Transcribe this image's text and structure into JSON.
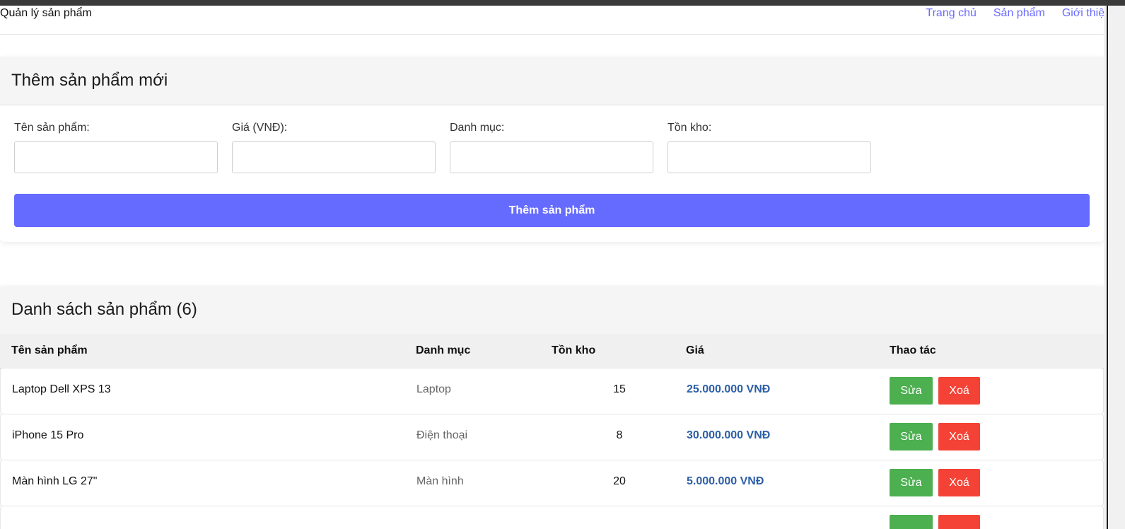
{
  "header": {
    "brand": "Quản lý sản phẩm",
    "nav": [
      "Trang chủ",
      "Sản phẩm",
      "Giới thiệu"
    ]
  },
  "add_form": {
    "title": "Thêm sản phẩm mới",
    "fields": [
      {
        "label": "Tên sản phẩm:",
        "value": ""
      },
      {
        "label": "Giá (VNĐ):",
        "value": ""
      },
      {
        "label": "Danh mục:",
        "value": ""
      },
      {
        "label": "Tồn kho:",
        "value": ""
      }
    ],
    "submit_label": "Thêm sản phẩm"
  },
  "product_list": {
    "title": "Danh sách sản phẩm (6)",
    "columns": [
      "Tên sản phẩm",
      "Danh mục",
      "Tồn kho",
      "Giá",
      "Thao tác"
    ],
    "rows": [
      {
        "name": "Laptop Dell XPS 13",
        "category": "Laptop",
        "stock": "15",
        "price": "25.000.000 VNĐ",
        "edit": "Sửa",
        "delete": "Xoá"
      },
      {
        "name": "iPhone 15 Pro",
        "category": "Điện thoại",
        "stock": "8",
        "price": "30.000.000 VNĐ",
        "edit": "Sửa",
        "delete": "Xoá"
      },
      {
        "name": "Màn hình LG 27\"",
        "category": "Màn hình",
        "stock": "20",
        "price": "5.000.000 VNĐ",
        "edit": "Sửa",
        "delete": "Xoá"
      },
      {
        "name": "",
        "category": "",
        "stock": "",
        "price": "",
        "edit": "",
        "delete": ""
      }
    ]
  },
  "colors": {
    "accent": "#666bff",
    "link": "#6a6bff",
    "edit_button": "#4caf50",
    "delete_button": "#f44336",
    "price_text": "#2d5fa6"
  }
}
